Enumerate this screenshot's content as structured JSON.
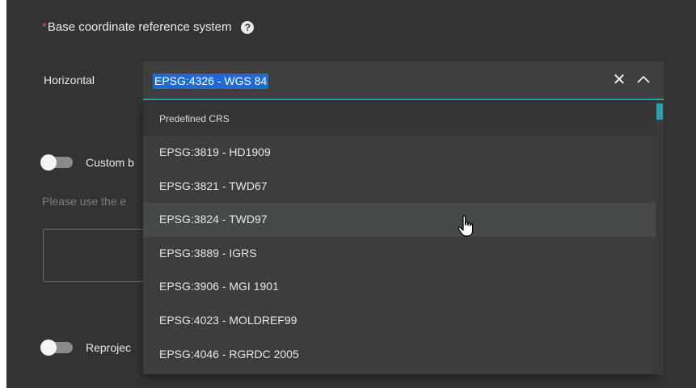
{
  "form": {
    "required_marker": "*",
    "section_title": "Base coordinate reference system",
    "help_glyph": "?",
    "horizontal_label": "Horizontal",
    "custom_toggle_label": "Custom b",
    "hint_text": "Please use the e",
    "reproject_toggle_label": "Reprojec"
  },
  "select": {
    "value": "EPSG:4326 - WGS 84",
    "clear_glyph": "✕",
    "accent_color": "#2aa1a8",
    "selection_color": "#1f6bd6"
  },
  "dropdown": {
    "group_header": "Predefined CRS",
    "options": [
      "EPSG:3819 - HD1909",
      "EPSG:3821 - TWD67",
      "EPSG:3824 - TWD97",
      "EPSG:3889 - IGRS",
      "EPSG:3906 - MGI 1901",
      "EPSG:4023 - MOLDREF99",
      "EPSG:4046 - RGRDC 2005"
    ],
    "hovered_option": "EPSG:3824 - TWD97"
  }
}
